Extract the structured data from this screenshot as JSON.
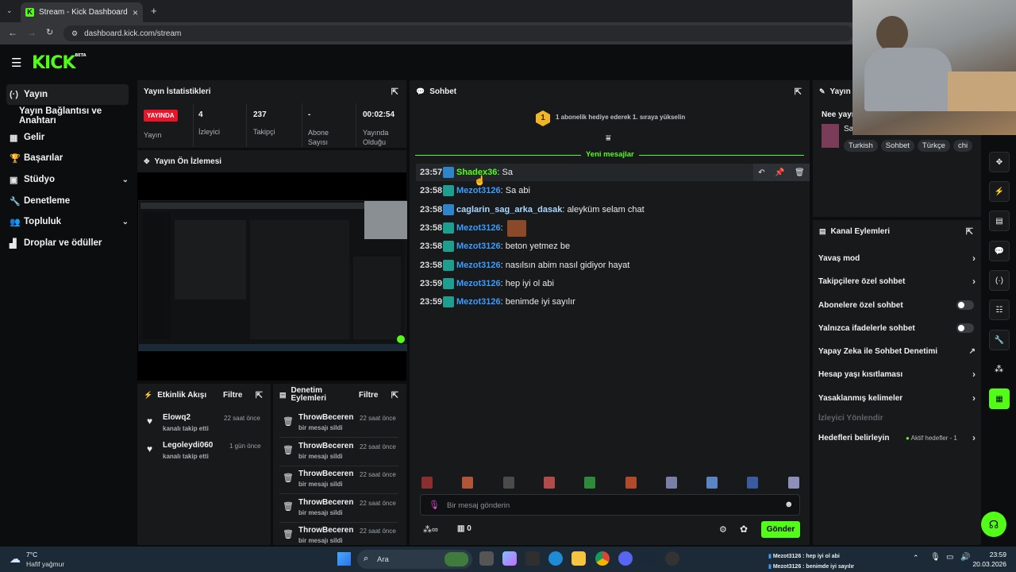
{
  "browser": {
    "tab_title": "Stream - Kick Dashboard",
    "url": "dashboard.kick.com/stream"
  },
  "brand": {
    "logo": "KICK",
    "logo_sup": "BETA",
    "accent": "#53fc18"
  },
  "sidebar": {
    "items": [
      {
        "label": "Yayın",
        "icon": "broadcast-icon"
      },
      {
        "label": "Yayın Bağlantısı ve Anahtarı",
        "icon": ""
      },
      {
        "label": "Gelir",
        "icon": "revenue-icon"
      },
      {
        "label": "Başarılar",
        "icon": "trophy-icon"
      },
      {
        "label": "Stüdyo",
        "icon": "studio-icon"
      },
      {
        "label": "Denetleme",
        "icon": "wrench-icon"
      },
      {
        "label": "Topluluk",
        "icon": "community-icon"
      },
      {
        "label": "Droplar ve ödüller",
        "icon": "gift-icon"
      }
    ]
  },
  "stats": {
    "title": "Yayın İstatistikleri",
    "live_badge": "YAYINDA",
    "live_label": "Yayın",
    "viewers_value": "4",
    "viewers_label": "İzleyici",
    "followers_value": "237",
    "followers_label": "Takipçi",
    "subs_value": "-",
    "subs_label": "Abone Sayısı",
    "uptime_value": "00:02:54",
    "uptime_label": "Yayında Olduğu"
  },
  "preview": {
    "title": "Yayın Ön İzlemesi"
  },
  "activity": {
    "title": "Etkinlik Akışı",
    "filter": "Filtre",
    "items": [
      {
        "name": "Elowq2",
        "desc": "kanalı takip etti",
        "time": "22 saat önce"
      },
      {
        "name": "Legoleydi060",
        "desc": "kanalı takip etti",
        "time": "1 gün önce"
      }
    ]
  },
  "moderation": {
    "title": "Denetim Eylemleri",
    "filter": "Filtre",
    "items": [
      {
        "name": "ThrowBeceren",
        "desc": "bir mesajı sildi",
        "time": "22 saat önce"
      },
      {
        "name": "ThrowBeceren",
        "desc": "bir mesajı sildi",
        "time": "22 saat önce"
      },
      {
        "name": "ThrowBeceren",
        "desc": "bir mesajı sildi",
        "time": "22 saat önce"
      },
      {
        "name": "ThrowBeceren",
        "desc": "bir mesajı sildi",
        "time": "22 saat önce"
      },
      {
        "name": "ThrowBeceren",
        "desc": "bir mesajı sildi",
        "time": "22 saat önce"
      }
    ]
  },
  "chat": {
    "title": "Sohbet",
    "gift_banner": "1 abonelik hediye ederek 1. sıraya yükselin",
    "gift_rank": "1",
    "new_messages": "Yeni mesajlar",
    "messages": [
      {
        "time": "23:57",
        "user": "Shadex36",
        "text": ": Sa",
        "color": "#53fc18",
        "badge": "blue"
      },
      {
        "time": "23:58",
        "user": "Mezot3126",
        "text": ": Sa abi",
        "color": "#3b9cff",
        "badge": "teal"
      },
      {
        "time": "23:58",
        "user": "caglarin_sag_arka_dasak",
        "text": ": aleyküm selam chat",
        "color": "#a9d8ff",
        "badge": "blue"
      },
      {
        "time": "23:58",
        "user": "Mezot3126",
        "text": ":",
        "color": "#3b9cff",
        "badge": "teal"
      },
      {
        "time": "23:58",
        "user": "Mezot3126",
        "text": ": beton yetmez be",
        "color": "#3b9cff",
        "badge": "teal"
      },
      {
        "time": "23:58",
        "user": "Mezot3126",
        "text": ": nasılsın abim nasıl gidiyor hayat",
        "color": "#3b9cff",
        "badge": "teal"
      },
      {
        "time": "23:59",
        "user": "Mezot3126",
        "text": ": hep iyi ol abi",
        "color": "#3b9cff",
        "badge": "teal"
      },
      {
        "time": "23:59",
        "user": "Mezot3126",
        "text": ": benimde iyi sayılır",
        "color": "#3b9cff",
        "badge": "teal"
      }
    ],
    "input_placeholder": "Bir mesaj gönderin",
    "points": "0",
    "send": "Gönder"
  },
  "stream_info": {
    "title": "Yayın Bilgileri",
    "stream_title": "Nee yayını",
    "channel_initial": "Sa",
    "tags": [
      "Turkish",
      "Sohbet",
      "Türkçe",
      "chi"
    ]
  },
  "channel_actions": {
    "title": "Kanal Eylemleri",
    "items": [
      {
        "label": "Yavaş mod",
        "control": "arrow"
      },
      {
        "label": "Takipçilere özel sohbet",
        "control": "arrow"
      },
      {
        "label": "Abonelere özel sohbet",
        "control": "toggle"
      },
      {
        "label": "Yalnızca ifadelerle sohbet",
        "control": "toggle"
      },
      {
        "label": "Yapay Zeka ile Sohbet Denetimi",
        "control": "external"
      },
      {
        "label": "Hesap yaşı kısıtlaması",
        "control": "arrow"
      },
      {
        "label": "Yasaklanmış kelimeler",
        "control": "arrow"
      }
    ],
    "viewer_directed": "İzleyici Yönlendir",
    "goals_label": "Hedefleri belirleyin",
    "goals_status": "Aktif hedefler - 1"
  },
  "taskbar": {
    "weather_temp": "7°C",
    "weather_desc": "Hafif yağmur",
    "search": "Ara",
    "notif_1": "Mezot3126 : hep iyi ol abi",
    "notif_2": "Mezot3126 : benimde iyi sayılır",
    "time": "23:59",
    "date": "20.03.2026"
  }
}
